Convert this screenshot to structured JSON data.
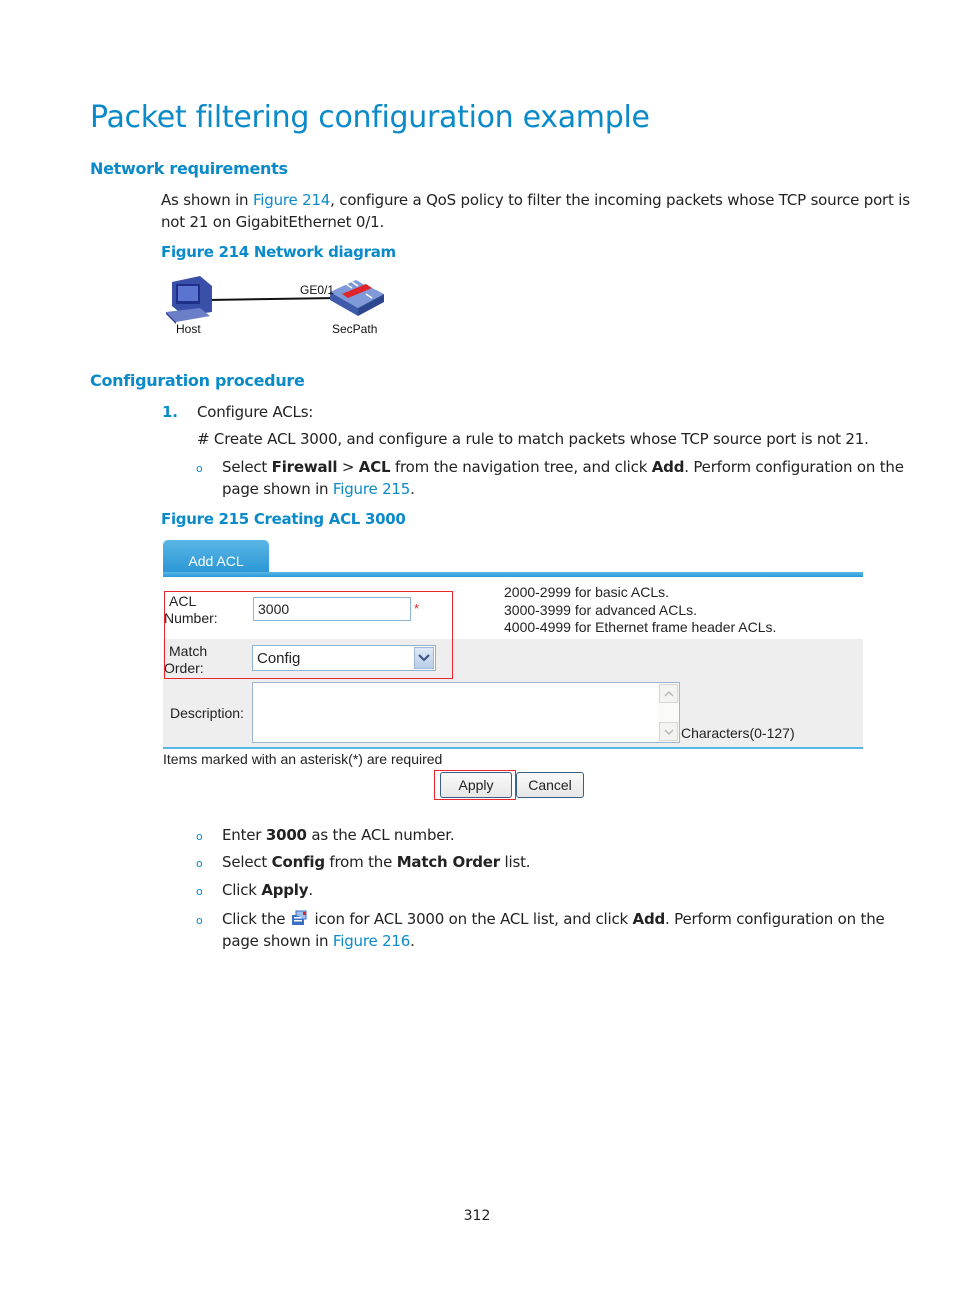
{
  "page": {
    "title": "Packet filtering configuration example",
    "page_number": "312"
  },
  "network_requirements": {
    "heading": "Network requirements",
    "para_prefix": "As shown in ",
    "para_link": "Figure 214",
    "para_suffix_line1": ", configure a QoS policy to filter the incoming packets whose TCP source port is",
    "para_line2": "not 21 on GigabitEthernet 0/1.",
    "figure_caption": "Figure 214 Network diagram",
    "diagram": {
      "host_label": "Host",
      "device_label": "SecPath",
      "port_label": "GE0/1",
      "host_icon": "computer-icon",
      "device_icon": "firewall-icon"
    }
  },
  "configuration_procedure": {
    "heading": "Configuration procedure",
    "step1": {
      "number": "1.",
      "label": "Configure ACLs:",
      "comment": "# Create ACL 3000, and configure a rule to match packets whose TCP source port is not 21.",
      "bullet1": {
        "t1": "Select ",
        "b1": "Firewall",
        "t2": " > ",
        "b2": "ACL",
        "t3": " from the navigation tree, and click ",
        "b3": "Add",
        "t4": ". Perform configuration on the",
        "t5": "page shown in ",
        "link": "Figure 215",
        "t6": "."
      }
    },
    "figure_caption": "Figure 215 Creating ACL 3000",
    "bullets_after": [
      {
        "t1": "Enter ",
        "b1": "3000",
        "t2": " as the ACL number."
      },
      {
        "t1": "Select ",
        "b1": "Config",
        "t2": " from the ",
        "b2": "Match Order",
        "t3": " list."
      },
      {
        "t1": "Click ",
        "b1": "Apply",
        "t2": "."
      }
    ],
    "bullet_last": {
      "t1": "Click the ",
      "icon": "acl-rule-icon",
      "t2": " icon for ACL 3000 on the ACL list, and click ",
      "b1": "Add",
      "t3": ". Perform configuration on the",
      "t4": "page shown in ",
      "link": "Figure 216",
      "t5": "."
    },
    "bullet_glyph": "o"
  },
  "acl_form": {
    "tab_label": "Add ACL",
    "acl_number_label_1": "ACL",
    "acl_number_label_2": "Number:",
    "acl_number_value": "3000",
    "required_mark": "*",
    "hint_lines": [
      "2000-2999 for basic ACLs.",
      "3000-3999 for advanced ACLs.",
      "4000-4999 for Ethernet frame header ACLs."
    ],
    "match_order_label_1": "Match",
    "match_order_label_2": "Order:",
    "match_order_value": "Config",
    "description_label": "Description:",
    "description_value": "",
    "description_hint": "Characters(0-127)",
    "required_note": "Items marked with an asterisk(*) are required",
    "apply_label": "Apply",
    "cancel_label": "Cancel",
    "highlight_color": "#e8262b",
    "accent_color": "#2a98d6"
  }
}
